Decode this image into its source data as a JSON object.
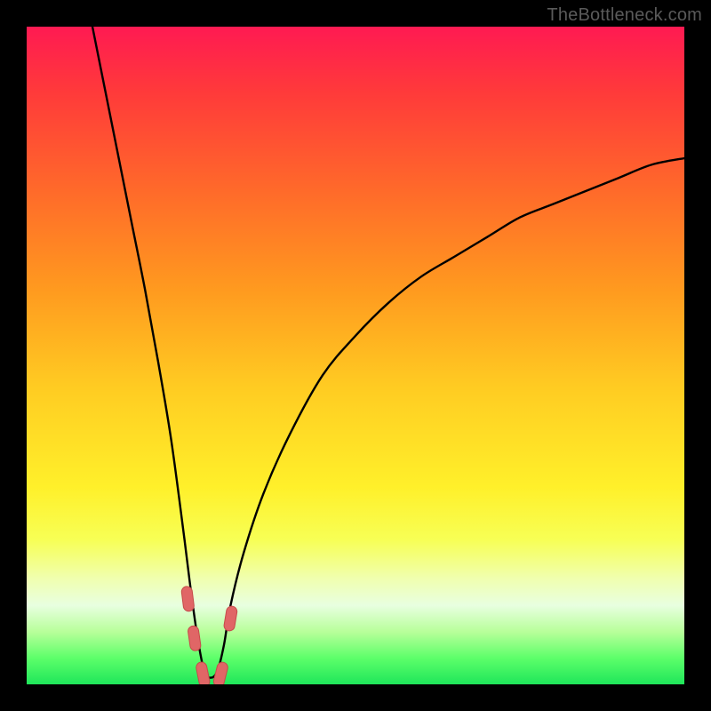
{
  "watermark": "TheBottleneck.com",
  "colors": {
    "frame": "#000000",
    "curve": "#000000",
    "marker_fill": "#e06666",
    "marker_stroke": "#c64a4a",
    "gradient_stops": [
      {
        "offset": 0.0,
        "color": "#ff1a52"
      },
      {
        "offset": 0.1,
        "color": "#ff3a3a"
      },
      {
        "offset": 0.25,
        "color": "#ff6a2a"
      },
      {
        "offset": 0.4,
        "color": "#ff9a1f"
      },
      {
        "offset": 0.55,
        "color": "#ffcc22"
      },
      {
        "offset": 0.7,
        "color": "#fff02a"
      },
      {
        "offset": 0.78,
        "color": "#f7ff55"
      },
      {
        "offset": 0.84,
        "color": "#f0ffb0"
      },
      {
        "offset": 0.88,
        "color": "#e8ffe0"
      },
      {
        "offset": 0.92,
        "color": "#b8ff9a"
      },
      {
        "offset": 0.96,
        "color": "#5dff6a"
      },
      {
        "offset": 1.0,
        "color": "#1fe65a"
      }
    ]
  },
  "chart_data": {
    "type": "line",
    "title": "",
    "xlabel": "",
    "ylabel": "",
    "xlim": [
      0,
      100
    ],
    "ylim": [
      0,
      100
    ],
    "grid": false,
    "notes": "V-shaped bottleneck curve. Y-axis is inverted visually (100 at top, 0 at bottom). Minimum near x≈27 where y≈1. Left branch starts near (10,100) and falls steeply; right branch rises with diminishing slope toward (100,~80). Axes are unlabeled; values are read off the 0–100 normalized plot extent.",
    "series": [
      {
        "name": "bottleneck-curve",
        "x": [
          10,
          12,
          14,
          16,
          18,
          20,
          22,
          24,
          25,
          26,
          27,
          28,
          29,
          30,
          31,
          33,
          36,
          40,
          45,
          50,
          55,
          60,
          65,
          70,
          75,
          80,
          85,
          90,
          95,
          100
        ],
        "y": [
          100,
          90,
          80,
          70,
          60,
          49,
          37,
          22,
          14,
          7,
          2,
          1,
          2,
          6,
          12,
          20,
          29,
          38,
          47,
          53,
          58,
          62,
          65,
          68,
          71,
          73,
          75,
          77,
          79,
          80
        ]
      }
    ],
    "markers": [
      {
        "x": 24.5,
        "y": 13,
        "shape": "pill-diagonal"
      },
      {
        "x": 25.5,
        "y": 7,
        "shape": "pill-diagonal"
      },
      {
        "x": 26.8,
        "y": 1.5,
        "shape": "pill-diagonal"
      },
      {
        "x": 29.5,
        "y": 1.5,
        "shape": "pill-diagonal"
      },
      {
        "x": 31.0,
        "y": 10,
        "shape": "pill-diagonal"
      }
    ]
  }
}
